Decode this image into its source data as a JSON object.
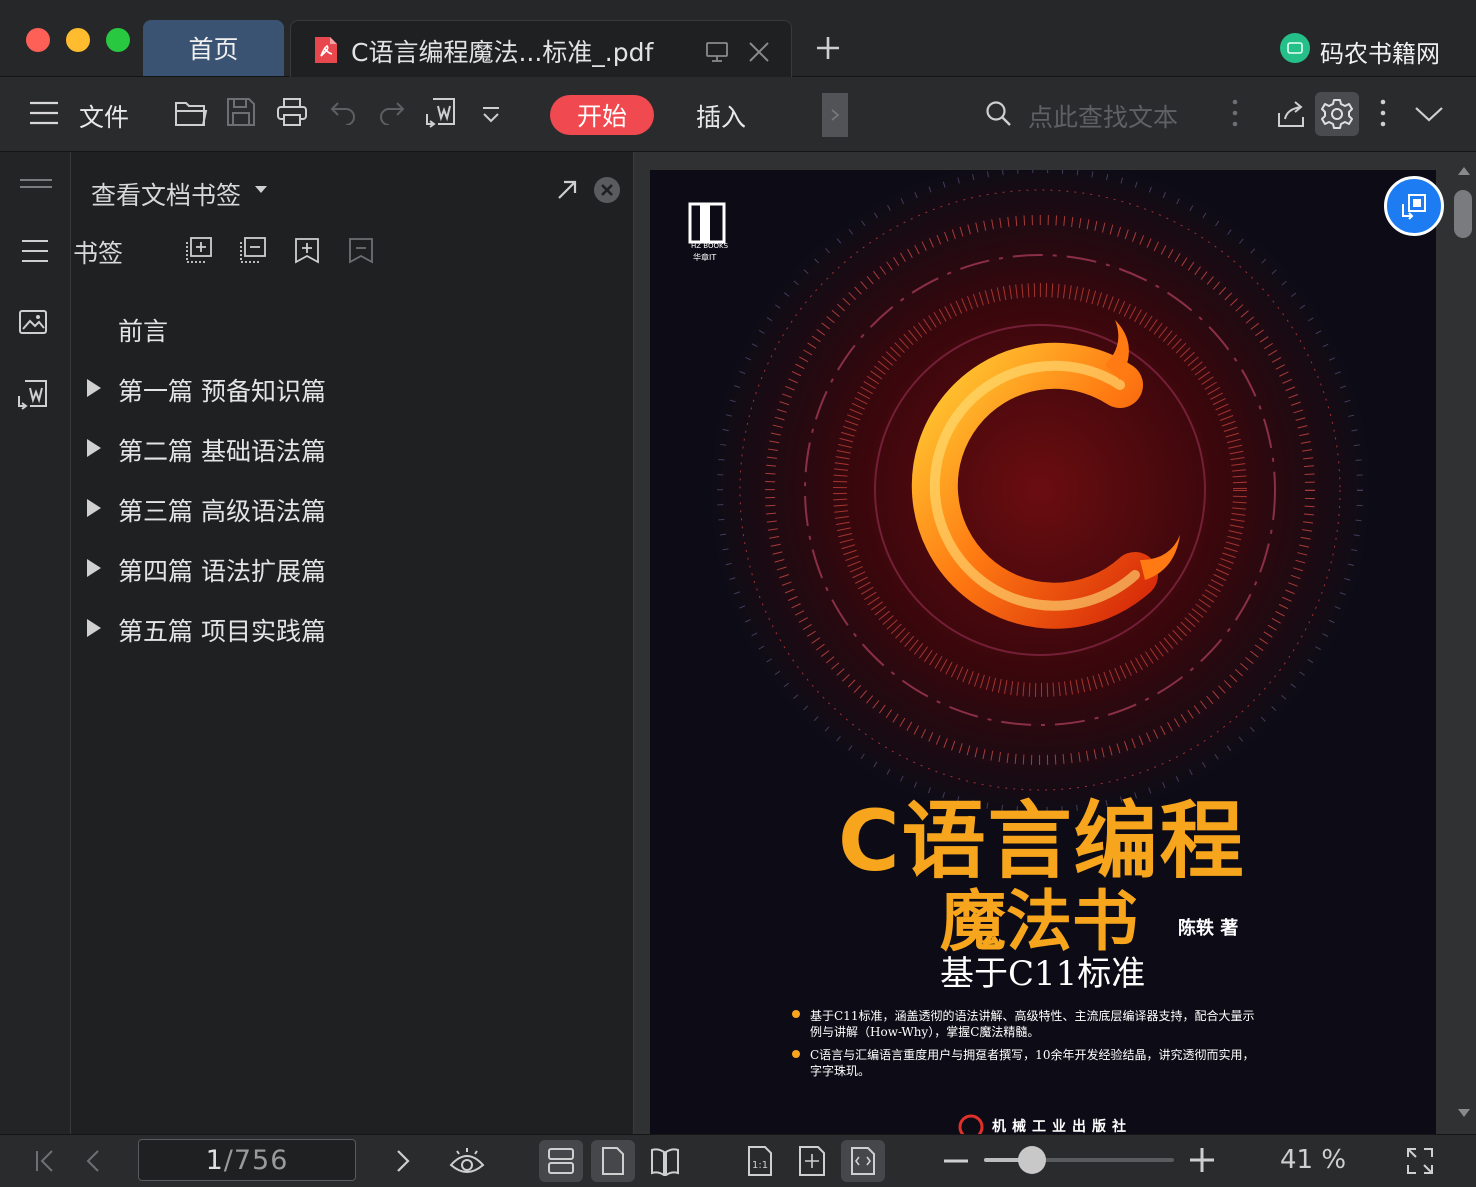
{
  "titlebar": {
    "tab_home": "首页",
    "tab_doc_title": "C语言编程魔法...标准_.pdf",
    "new_tab": "+",
    "brand_name": "码农书籍网"
  },
  "toolbar": {
    "file_label": "文件",
    "start_label": "开始",
    "insert_label": "插入",
    "search_placeholder": "点此查找文本"
  },
  "panel": {
    "title": "查看文档书签",
    "bookmarks_label": "书签",
    "items": [
      {
        "label": "前言",
        "expandable": false
      },
      {
        "label": "第一篇 预备知识篇",
        "expandable": true
      },
      {
        "label": "第二篇 基础语法篇",
        "expandable": true
      },
      {
        "label": "第三篇 高级语法篇",
        "expandable": true
      },
      {
        "label": "第四篇 语法扩展篇",
        "expandable": true
      },
      {
        "label": "第五篇 项目实践篇",
        "expandable": true
      }
    ]
  },
  "cover": {
    "publisher_logo": "HZ BOOKS",
    "publisher_logo_sub": "华章IT",
    "title_line1": "C语言编程",
    "title_line2": "魔法书",
    "author": "陈轶 著",
    "subtitle": "基于C11标准",
    "bullet1_line1": "基于C11标准，涵盖透彻的语法讲解、高级特性、主流底层编译器支持，配合大量示",
    "bullet1_line2": "例与讲解（How-Why），掌握C魔法精髓。",
    "bullet2_line1": "C语言与汇编语言重度用户与拥趸者撰写，10余年开发经验结晶，讲究透彻而实用，",
    "bullet2_line2": "字字珠玑。",
    "press": "机械工业出版社"
  },
  "bottombar": {
    "page_current": "1",
    "page_total": "/756",
    "zoom_label": "41 %",
    "zoom_fraction": 0.25
  },
  "colors": {
    "accent_red": "#f0494f",
    "tab_home_bg": "#3b5373",
    "cover_title": "#f7a51c",
    "float_button": "#1e7cf2"
  }
}
